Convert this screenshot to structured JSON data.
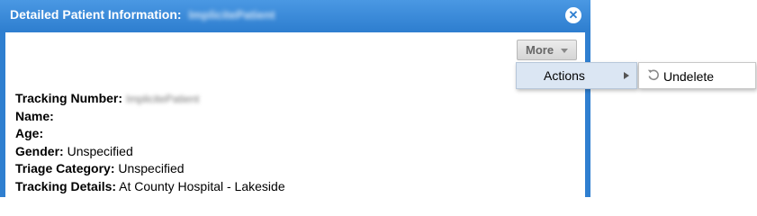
{
  "dialog": {
    "title": "Detailed Patient Information:",
    "title_name": "ImplicitePatient",
    "close_icon": "close-circle-icon"
  },
  "toolbar": {
    "more_label": "More",
    "more_icon": "chevron-down-icon"
  },
  "menu": {
    "actions_label": "Actions",
    "actions_icon": "chevron-right-icon",
    "undelete_label": "Undelete",
    "undelete_icon": "undo-icon"
  },
  "patient": {
    "tracking_number_label": "Tracking Number:",
    "tracking_number_value": "ImplicitePatient",
    "name_label": "Name:",
    "name_value": "",
    "age_label": "Age:",
    "age_value": "",
    "gender_label": "Gender:",
    "gender_value": "Unspecified",
    "triage_label": "Triage Category:",
    "triage_value": "Unspecified",
    "tracking_details_label": "Tracking Details:",
    "tracking_details_value": "At County Hospital - Lakeside"
  },
  "colors": {
    "dialog_border": "#2f7fd0",
    "menu_highlight": "#dbe6f3"
  }
}
